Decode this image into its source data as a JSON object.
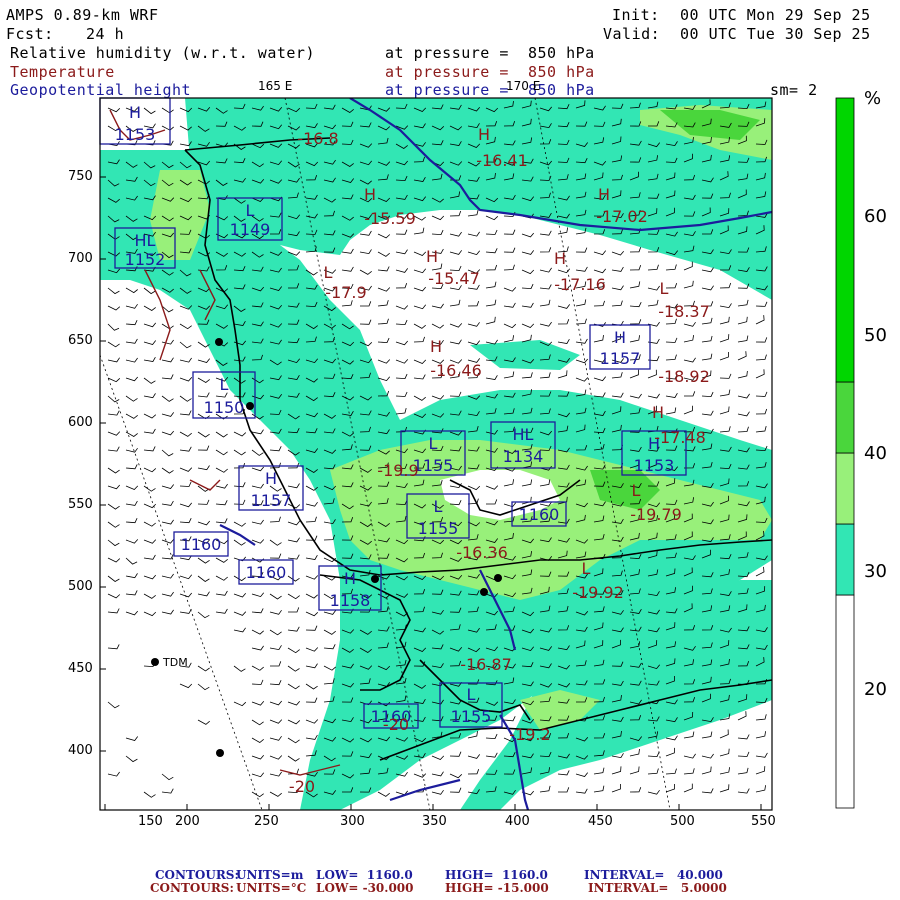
{
  "header": {
    "model": "AMPS 0.89-km WRF",
    "fcst_label": "Fcst:",
    "fcst_value": "24 h",
    "init_label": "Init:",
    "init_value": "00 UTC Mon 29 Sep 25",
    "valid_label": "Valid:",
    "valid_value": "00 UTC Tue 30 Sep 25",
    "sm": "sm= 2"
  },
  "fields": [
    {
      "name": "Relative humidity (w.r.t. water)",
      "level": "at pressure =  850 hPa",
      "color": "#000000"
    },
    {
      "name": "Temperature",
      "level": "at pressure =  850 hPa",
      "color": "#8b1a1a"
    },
    {
      "name": "Geopotential height",
      "level": "at pressure =  850 hPa",
      "color": "#1c1c9c"
    }
  ],
  "longitude_labels": [
    "165 E",
    "170 E"
  ],
  "axes": {
    "x_ticks": [
      "150",
      "200",
      "250",
      "300",
      "350",
      "400",
      "450",
      "500",
      "550"
    ],
    "y_ticks": [
      "750",
      "700",
      "650",
      "600",
      "550",
      "500",
      "450",
      "400"
    ]
  },
  "colorbar": {
    "unit": "%",
    "ticks": [
      "60",
      "50",
      "40",
      "30",
      "20"
    ],
    "colors": [
      "#ffffff",
      "#32e6b4",
      "#98f07a",
      "#4ad63c",
      "#00d600"
    ],
    "bounds": [
      0,
      30,
      40,
      50,
      60,
      100
    ]
  },
  "station_label": "TDM",
  "height_boxes": [
    {
      "label": "L",
      "value": "1149"
    },
    {
      "label": "HL",
      "value": "1152"
    },
    {
      "label": "H",
      "value": "1153"
    },
    {
      "label": "H",
      "value": "1157"
    },
    {
      "label": "L",
      "value": "1150"
    },
    {
      "label": "H",
      "value": "1157"
    },
    {
      "label": "L",
      "value": "1155"
    },
    {
      "label": "HL",
      "value": "1134"
    },
    {
      "label": "H",
      "value": "1153"
    },
    {
      "label": "L",
      "value": "1155"
    },
    {
      "label": "",
      "value": "1160"
    },
    {
      "label": "",
      "value": "1160"
    },
    {
      "label": "",
      "value": "1160"
    },
    {
      "label": "H",
      "value": "1158"
    },
    {
      "label": "",
      "value": "1160"
    },
    {
      "label": "L",
      "value": "1155"
    }
  ],
  "temperature_labels": [
    {
      "label": "H",
      "value": "-16.41"
    },
    {
      "label": "H",
      "value": "-15.59"
    },
    {
      "label": "H",
      "value": "-17.02"
    },
    {
      "label": "H",
      "value": "-15.47"
    },
    {
      "label": "H",
      "value": "-17.16"
    },
    {
      "label": "L",
      "value": "-17.9"
    },
    {
      "label": "L",
      "value": "-18.37"
    },
    {
      "label": "H",
      "value": "-16.46"
    },
    {
      "label": "",
      "value": "-18.92"
    },
    {
      "label": "H",
      "value": "-17.48"
    },
    {
      "label": "L",
      "value": "-19.79"
    },
    {
      "label": "",
      "value": "-19.9"
    },
    {
      "label": "",
      "value": "-16.36"
    },
    {
      "label": "L",
      "value": "-19.92"
    },
    {
      "label": "",
      "value": "-16.87"
    },
    {
      "label": "",
      "value": "-19.2"
    },
    {
      "label": "",
      "value": "-20"
    },
    {
      "label": "",
      "value": "-16.8"
    },
    {
      "label": "",
      "value": "-20"
    }
  ],
  "footer": {
    "line1": {
      "label": "CONTOURS:",
      "units": "UNITS=m",
      "low": "LOW=  1160.0",
      "high": "HIGH=  1160.0",
      "interval": "INTERVAL=   40.000"
    },
    "line2": {
      "label": "CONTOURS:",
      "units": "UNITS=°C",
      "low": "LOW= -30.000",
      "high": "HIGH= -15.000",
      "interval": "INTERVAL=   5.0000"
    }
  }
}
